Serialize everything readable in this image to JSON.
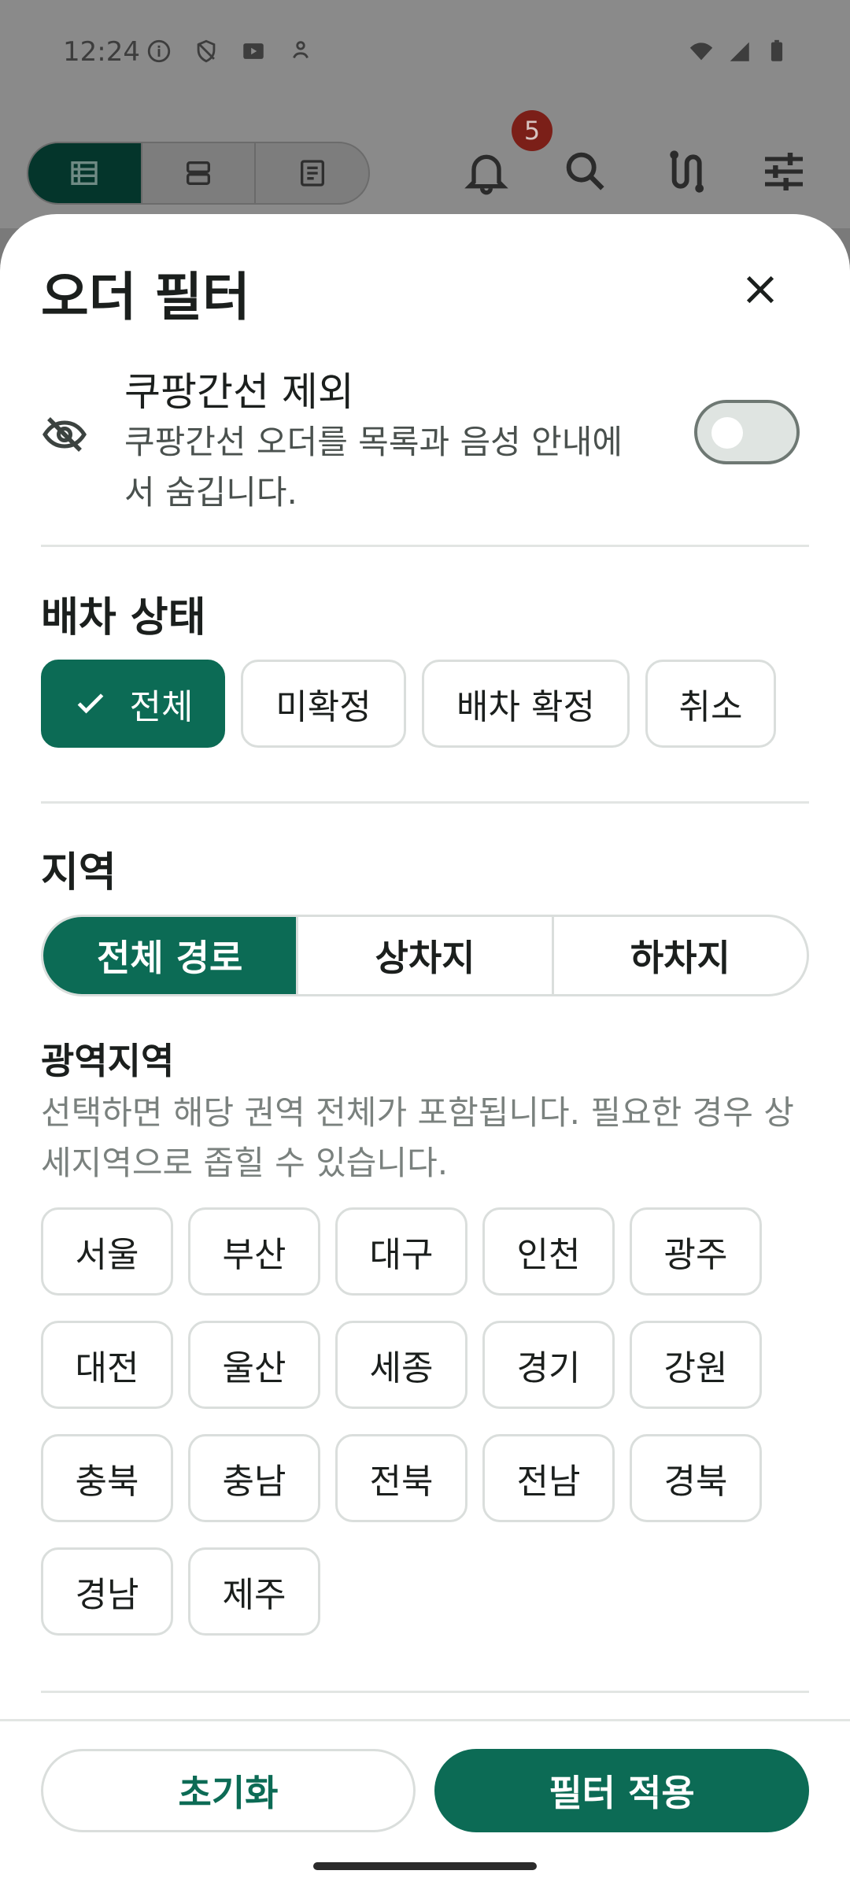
{
  "status_bar": {
    "time": "12:24",
    "left_icons": [
      "info-icon",
      "shield-icon",
      "play-icon",
      "accessibility-icon"
    ],
    "right_icons": [
      "wifi-icon",
      "signal-icon",
      "battery-icon"
    ]
  },
  "background_toolbar": {
    "view_modes": [
      "list-icon",
      "card-icon",
      "document-icon"
    ],
    "active_view": 0,
    "notification_count": "5",
    "icons": [
      "bell-icon",
      "search-icon",
      "route-icon",
      "sliders-icon"
    ]
  },
  "sheet": {
    "title": "오더 필터",
    "exclude": {
      "title": "쿠팡간선 제외",
      "description": "쿠팡간선 오더를 목록과 음성 안내에서 숨깁니다.",
      "enabled": false
    },
    "dispatch": {
      "title": "배차 상태",
      "options": [
        "전체",
        "미확정",
        "배차 확정",
        "취소"
      ],
      "selected": "전체"
    },
    "region": {
      "title": "지역",
      "segments": [
        "전체 경로",
        "상차지",
        "하차지"
      ],
      "selected_segment": "전체 경로",
      "metro": {
        "title": "광역지역",
        "description": "선택하면 해당 권역 전체가 포함됩니다. 필요한 경우 상세지역으로 좁힐 수 있습니다.",
        "areas": [
          "서울",
          "부산",
          "대구",
          "인천",
          "광주",
          "대전",
          "울산",
          "세종",
          "경기",
          "강원",
          "충북",
          "충남",
          "전북",
          "전남",
          "경북",
          "경남",
          "제주"
        ]
      }
    },
    "footer": {
      "reset_label": "초기화",
      "apply_label": "필터 적용"
    }
  },
  "colors": {
    "accent": "#0c6b55",
    "badge": "#7b1f18"
  }
}
